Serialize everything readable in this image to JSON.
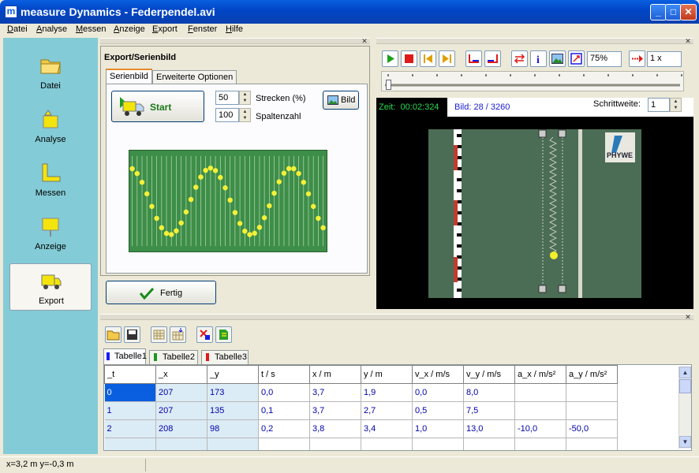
{
  "window": {
    "title": "measure Dynamics - Federpendel.avi",
    "app_icon": "m"
  },
  "menu": [
    "Datei",
    "Analyse",
    "Messen",
    "Anzeige",
    "Export",
    "Fenster",
    "Hilfe"
  ],
  "sidebar": [
    {
      "label": "Datei",
      "icon": "folder-icon"
    },
    {
      "label": "Analyse",
      "icon": "analyse-icon"
    },
    {
      "label": "Messen",
      "icon": "ruler-icon"
    },
    {
      "label": "Anzeige",
      "icon": "sign-icon"
    },
    {
      "label": "Export",
      "icon": "truck-icon",
      "active": true
    }
  ],
  "export_panel": {
    "title": "Export/Serienbild",
    "tabs": [
      "Serienbild",
      "Erweiterte Optionen"
    ],
    "start_label": "Start",
    "strecken_value": "50",
    "strecken_label": "Strecken (%)",
    "spalten_value": "100",
    "spalten_label": "Spaltenzahl",
    "bild_label": "Bild",
    "fertig_label": "Fertig"
  },
  "video": {
    "zoom": "75%",
    "speed": "1 x",
    "zeit_label": "Zeit:",
    "zeit_value": "00:02:324",
    "bild_label": "Bild: 28 / 3260",
    "schritt_label": "Schrittweite:",
    "schritt_value": "1",
    "logo_text": "PHYWE"
  },
  "table": {
    "tabs": [
      {
        "label": "Tabelle1",
        "color": "#1a1aff"
      },
      {
        "label": "Tabelle2",
        "color": "#1a9a1a"
      },
      {
        "label": "Tabelle3",
        "color": "#e01a1a"
      }
    ],
    "headers": [
      "_t",
      "_x",
      "_y",
      "t / s",
      "x / m",
      "y / m",
      "v_x / m/s",
      "v_y / m/s",
      "a_x / m/s²",
      "a_y / m/s²"
    ],
    "rows": [
      [
        "0",
        "207",
        "173",
        "0,0",
        "3,7",
        "1,9",
        "0,0",
        "8,0",
        "",
        ""
      ],
      [
        "1",
        "207",
        "135",
        "0,1",
        "3,7",
        "2,7",
        "0,5",
        "7,5",
        "",
        ""
      ],
      [
        "2",
        "208",
        "98",
        "0,2",
        "3,8",
        "3,4",
        "1,0",
        "13,0",
        "-10,0",
        "-50,0"
      ]
    ]
  },
  "status": {
    "coords": "x=3,2 m  y=-0,3 m"
  },
  "colors": {
    "sidebar": "#83cbd6",
    "selection": "#0a5fe0",
    "strob_bg": "#3d8e48"
  }
}
